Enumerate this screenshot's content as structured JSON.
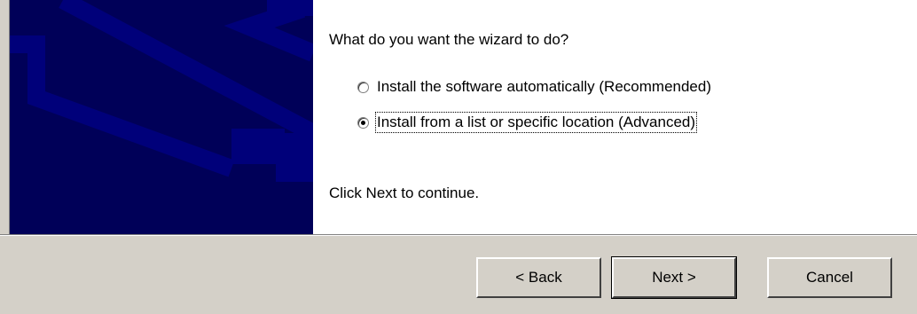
{
  "wizard": {
    "question": "What do you want the wizard to do?",
    "options": [
      {
        "label": "Install the software automatically (Recommended)",
        "selected": false
      },
      {
        "label": "Install from a list or specific location (Advanced)",
        "selected": true
      }
    ],
    "hint": "Click Next to continue."
  },
  "buttons": {
    "back": "< Back",
    "next": "Next >",
    "cancel": "Cancel"
  },
  "colors": {
    "bitmap_bg": "#000058",
    "bitmap_pattern": "#00007a",
    "dialog_bg": "#d4d0c8"
  }
}
